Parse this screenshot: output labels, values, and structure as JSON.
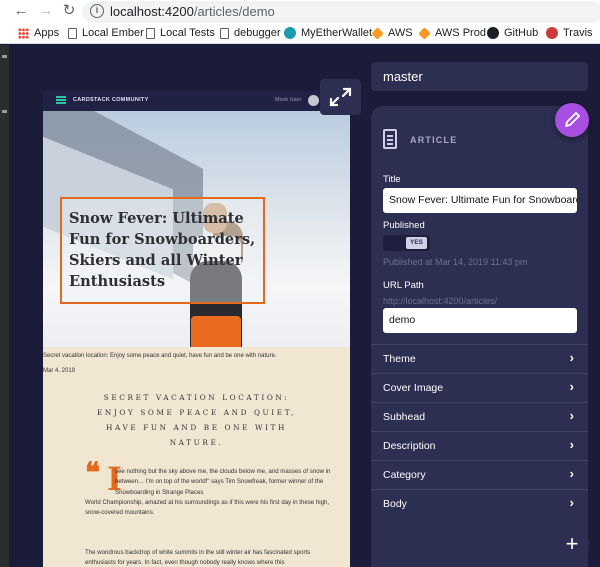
{
  "browser": {
    "url_host": "localhost:4200",
    "url_path": "/articles/demo",
    "bookmarks": [
      {
        "label": "Apps",
        "icon": "apps-grid-icon"
      },
      {
        "label": "Local Ember",
        "icon": "page-icon"
      },
      {
        "label": "Local Tests",
        "icon": "page-icon"
      },
      {
        "label": "debugger",
        "icon": "page-icon"
      },
      {
        "label": "MyEtherWallet",
        "icon": "ether-wallet-icon"
      },
      {
        "label": "AWS",
        "icon": "aws-icon"
      },
      {
        "label": "AWS Prod",
        "icon": "aws-icon"
      },
      {
        "label": "GitHub",
        "icon": "github-icon"
      },
      {
        "label": "Travis",
        "icon": "travis-icon"
      }
    ]
  },
  "preview": {
    "brand": "CARDSTACK COMMUNITY",
    "user": "Mock User",
    "title": "Snow Fever: Ultimate Fun for Snowboarders, Skiers and all Winter Enthusiasts",
    "caption": "Secret vacation location: Enjoy some peace and quiet, have fun and be one with nature.",
    "date": "Mar 4, 2019",
    "subhead": "SECRET VACATION LOCATION: ENJOY SOME PEACE AND QUIET, HAVE FUN AND BE ONE WITH NATURE.",
    "quote_mark": "❝",
    "drop_cap": "I",
    "body_para_1_first": "see nothing but the sky above me, the clouds below me, and masses of snow in between… I'm on top of the world!\" says Tim Snowfreak, former winner of the Snowboarding in Strange Places",
    "body_para_1_rest": "World Championship, amazed at his surroundings as if this were his first day in these high, snow-covered mountains.",
    "body_para_2": "The wondrous backdrop of white summits in the still winter air has fascinated sports enthusiasts for years. In fact, even though nobody really knows where this"
  },
  "editor": {
    "branch": "master",
    "card_type": "ARTICLE",
    "title_label": "Title",
    "title_value": "Snow Fever: Ultimate Fun for Snowboarders, Skiers and all Winter Enthusiasts",
    "published_label": "Published",
    "published_toggle": "YES",
    "published_at": "Published at Mar 14, 2019 11:43 pm",
    "url_label": "URL Path",
    "url_prefix": "http://localhost:4200/articles/",
    "url_value": "demo",
    "sections": [
      "Theme",
      "Cover Image",
      "Subhead",
      "Description",
      "Category",
      "Body"
    ]
  },
  "colors": {
    "accent_orange": "#e36a1c",
    "fab_purple": "#a64fe0",
    "panel_bg": "#2c2e52",
    "app_bg": "#1b1c3a"
  }
}
